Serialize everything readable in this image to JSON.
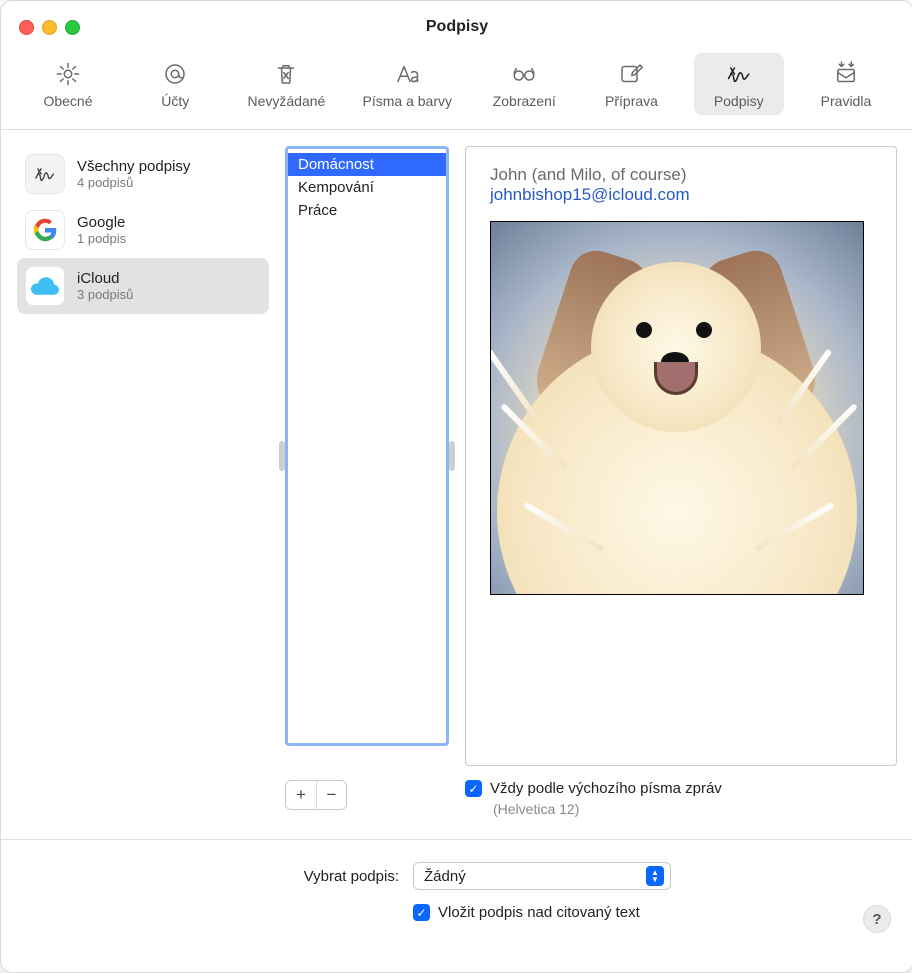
{
  "window": {
    "title": "Podpisy"
  },
  "toolbar": {
    "general": "Obecné",
    "accounts": "Účty",
    "junk": "Nevyžádané",
    "fonts": "Písma a barvy",
    "viewing": "Zobrazení",
    "composing": "Příprava",
    "signatures": "Podpisy",
    "rules": "Pravidla"
  },
  "accounts": [
    {
      "name": "Všechny podpisy",
      "sub": "4 podpisů",
      "icon": "signature",
      "selected": false
    },
    {
      "name": "Google",
      "sub": "1 podpis",
      "icon": "google",
      "selected": false
    },
    {
      "name": "iCloud",
      "sub": "3 podpisů",
      "icon": "icloud",
      "selected": true
    }
  ],
  "signatures": [
    {
      "label": "Domácnost",
      "selected": true
    },
    {
      "label": "Kempování",
      "selected": false
    },
    {
      "label": "Práce",
      "selected": false
    }
  ],
  "preview": {
    "display_name": "John (and Milo, of course)",
    "email": "johnbishop15@icloud.com"
  },
  "controls": {
    "plus": "+",
    "minus": "−",
    "match_font_label": "Vždy podle výchozího písma zpráv",
    "font_display": "(Helvetica 12)"
  },
  "footer": {
    "choose_label": "Vybrat podpis:",
    "choose_value": "Žádný",
    "above_quoted_label": "Vložit podpis nad citovaný text",
    "help": "?"
  }
}
